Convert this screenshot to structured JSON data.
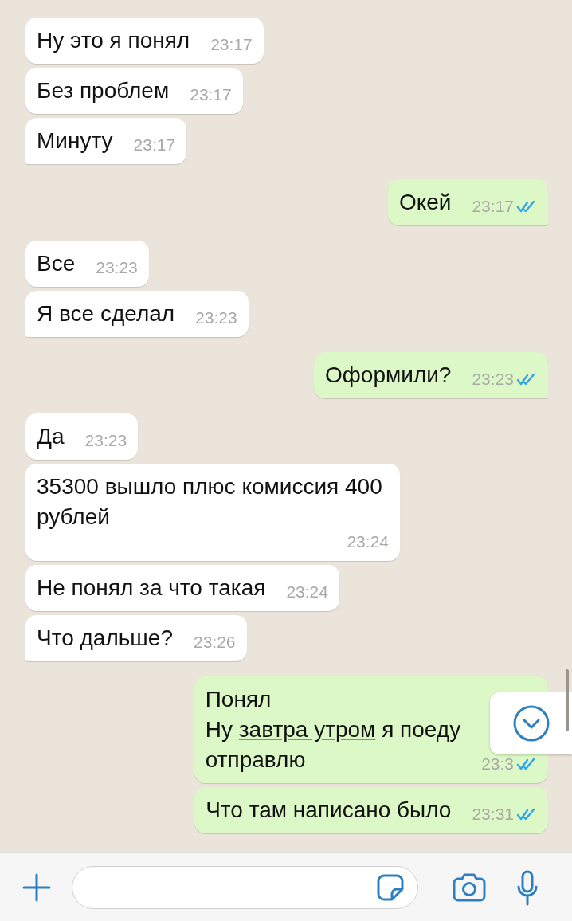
{
  "messages": [
    {
      "kind": "in",
      "parts": [
        {
          "text": "Ну это я понял"
        }
      ],
      "time": "23:17",
      "tail": false
    },
    {
      "kind": "in",
      "parts": [
        {
          "text": "Без проблем"
        }
      ],
      "time": "23:17",
      "tail": false
    },
    {
      "kind": "in",
      "parts": [
        {
          "text": "Минуту"
        }
      ],
      "time": "23:17",
      "tail": true
    },
    {
      "kind": "out",
      "parts": [
        {
          "text": "Окей"
        }
      ],
      "time": "23:17",
      "tail": true,
      "read": true
    },
    {
      "kind": "in",
      "parts": [
        {
          "text": "Все"
        }
      ],
      "time": "23:23",
      "tail": false
    },
    {
      "kind": "in",
      "parts": [
        {
          "text": "Я все сделал"
        }
      ],
      "time": "23:23",
      "tail": true
    },
    {
      "kind": "out",
      "parts": [
        {
          "text": "Оформили?"
        }
      ],
      "time": "23:23",
      "tail": true,
      "read": true
    },
    {
      "kind": "in",
      "parts": [
        {
          "text": "Да"
        }
      ],
      "time": "23:23",
      "tail": false
    },
    {
      "kind": "in",
      "parts": [
        {
          "text": "35300 вышло плюс комиссия 400 рублей"
        }
      ],
      "time": "23:24",
      "tail": false
    },
    {
      "kind": "in",
      "parts": [
        {
          "text": "Не понял за что такая"
        }
      ],
      "time": "23:24",
      "tail": false
    },
    {
      "kind": "in",
      "parts": [
        {
          "text": "Что дальше?"
        }
      ],
      "time": "23:26",
      "tail": true
    },
    {
      "kind": "out",
      "parts": [
        {
          "text": "Понял\nНу "
        },
        {
          "text": "завтра утром",
          "link": true
        },
        {
          "text": " я поеду\nотправлю"
        }
      ],
      "time": "23:3",
      "tail": false,
      "read": true
    },
    {
      "kind": "out",
      "parts": [
        {
          "text": "Что там написано было"
        }
      ],
      "time": "23:31",
      "tail": false,
      "read": true
    }
  ]
}
